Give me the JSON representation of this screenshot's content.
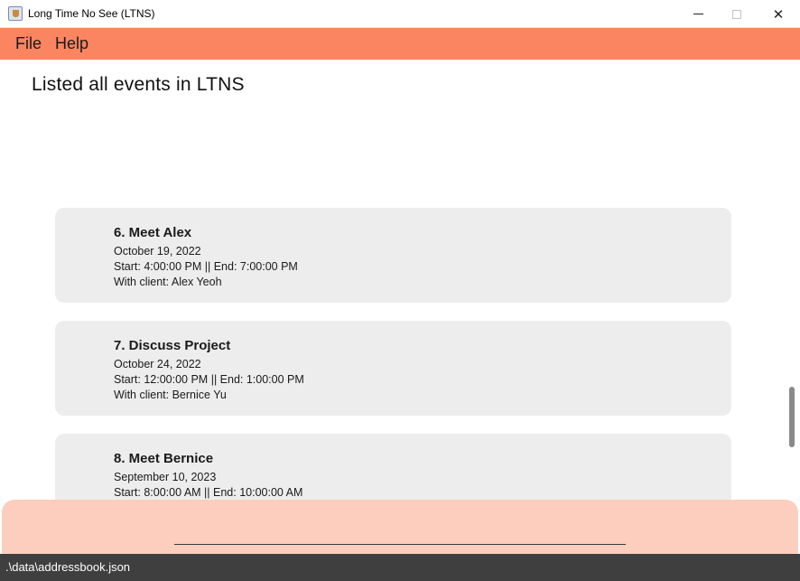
{
  "window": {
    "title": "Long Time No See (LTNS)",
    "minimize_glyph": "",
    "maximize_glyph": "",
    "close_glyph": "✕"
  },
  "menu": {
    "file_label": "File",
    "help_label": "Help"
  },
  "result_display": {
    "text": "Listed all events in LTNS"
  },
  "events": [
    {
      "title": "6.  Meet Alex",
      "date": "October 19, 2022",
      "time": "Start: 4:00:00 PM || End: 7:00:00 PM",
      "client": "With client: Alex Yeoh"
    },
    {
      "title": "7.  Discuss Project",
      "date": "October 24, 2022",
      "time": "Start: 12:00:00 PM || End: 1:00:00 PM",
      "client": "With client: Bernice Yu"
    },
    {
      "title": "8.  Meet Bernice",
      "date": "September 10, 2023",
      "time": "Start: 8:00:00 AM || End: 10:00:00 AM",
      "client": ""
    }
  ],
  "command": {
    "value": "",
    "placeholder": ""
  },
  "status": {
    "path": ".\\data\\addressbook.json"
  },
  "colors": {
    "menubar": "#fb8561",
    "command_box": "#fdcdbd",
    "card": "#ededed",
    "statusbar": "#3f3f3f"
  }
}
